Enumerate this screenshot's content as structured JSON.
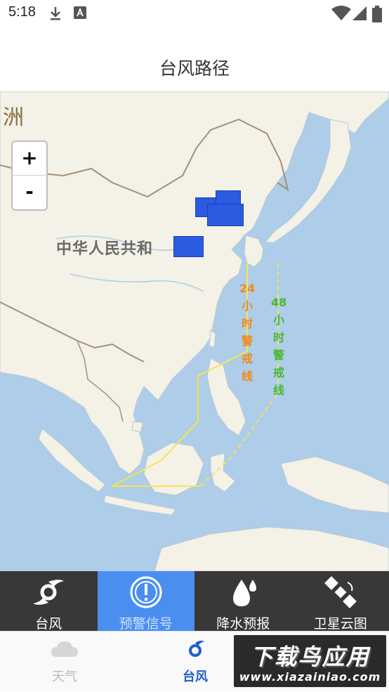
{
  "status_bar": {
    "time": "5:18"
  },
  "header": {
    "title": "台风路径"
  },
  "map": {
    "continent_label": "洲",
    "country_label": "中华人民共和",
    "zoom_in_label": "+",
    "zoom_out_label": "-",
    "warning_24": {
      "label": "24小时警戒线",
      "color": "#f08a19"
    },
    "warning_48": {
      "label": "48小时警戒线",
      "color": "#4ab634"
    }
  },
  "function_tabs": [
    {
      "label": "台风",
      "icon": "typhoon-icon",
      "active": false
    },
    {
      "label": "预警信号",
      "icon": "warning-signal-icon",
      "active": true
    },
    {
      "label": "降水预报",
      "icon": "raindrop-icon",
      "active": false
    },
    {
      "label": "卫星云图",
      "icon": "satellite-icon",
      "active": false
    }
  ],
  "bottom_nav": [
    {
      "label": "天气",
      "icon": "cloud-icon",
      "active": false
    },
    {
      "label": "台风",
      "icon": "typhoon-icon",
      "active": true
    }
  ],
  "watermark": {
    "main": "下载鸟应用",
    "url": "www.xiazainiao.com"
  },
  "colors": {
    "active_tab": "#4a8ff0",
    "accent": "#1e5fd0",
    "func_bar": "#383838"
  }
}
